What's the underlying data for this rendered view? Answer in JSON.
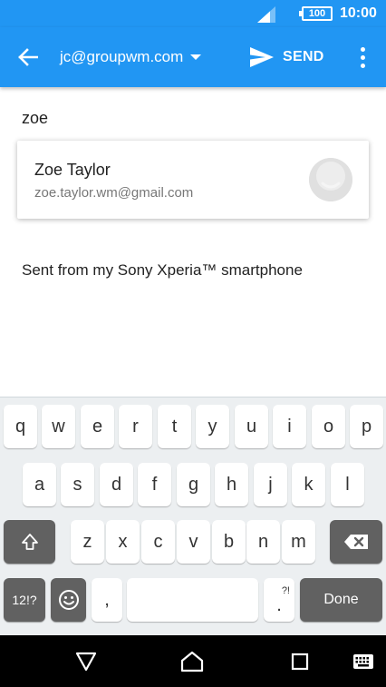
{
  "status_bar": {
    "battery": "100",
    "time": "10:00"
  },
  "app_bar": {
    "account": "jc@groupwm.com",
    "send_label": "SEND"
  },
  "compose": {
    "to_value": "zoe",
    "body": "Sent from my Sony Xperia™ smartphone"
  },
  "suggestion": {
    "name": "Zoe Taylor",
    "email": "zoe.taylor.wm@gmail.com"
  },
  "keyboard": {
    "row1": [
      "q",
      "w",
      "e",
      "r",
      "t",
      "y",
      "u",
      "i",
      "o",
      "p"
    ],
    "row2": [
      "a",
      "s",
      "d",
      "f",
      "g",
      "h",
      "j",
      "k",
      "l"
    ],
    "row3": [
      "z",
      "x",
      "c",
      "v",
      "b",
      "n",
      "m"
    ],
    "symbols_label": "12!?",
    "comma": ",",
    "punct_top": "?!",
    "period": ".",
    "done_label": "Done"
  },
  "colors": {
    "accent": "#2196f3",
    "dark_key": "#616161"
  }
}
